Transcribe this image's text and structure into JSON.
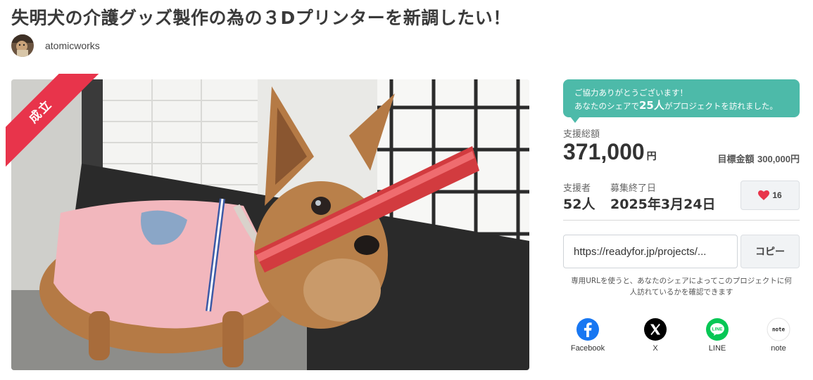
{
  "project": {
    "title": "失明犬の介護グッズ製作の為の３Dプリンターを新調したい！",
    "owner_name": "atomicworks",
    "status_ribbon": "成立"
  },
  "share_banner": {
    "line1": "ご協力ありがとうございます！",
    "line2_prefix": "あなたのシェアで",
    "line2_count": "25人",
    "line2_suffix": "がプロジェクトを訪れました。",
    "color": "#4dbaa9"
  },
  "stats": {
    "total_label": "支援総額",
    "total_amount": "371,000",
    "total_unit": "円",
    "goal_label": "目標金額",
    "goal_value": "300,000円",
    "supporters_label": "支援者",
    "supporters_value": "52人",
    "end_label": "募集終了日",
    "end_value": "2025年3月24日"
  },
  "like": {
    "icon": "heart-icon",
    "count": "16",
    "color": "#e8344b"
  },
  "share_url": {
    "value": "https://readyfor.jp/projects/...",
    "copy_label": "コピー",
    "note": "専用URLを使うと、あなたのシェアによってこのプロジェクトに何人訪れているかを確認できます"
  },
  "social": [
    {
      "name": "Facebook",
      "icon": "facebook-icon",
      "color": "#1877f2"
    },
    {
      "name": "X",
      "icon": "x-icon",
      "color": "#000000"
    },
    {
      "name": "LINE",
      "icon": "line-icon",
      "color": "#06c755"
    },
    {
      "name": "note",
      "icon": "note-icon",
      "color": "#222222"
    }
  ],
  "colors": {
    "ribbon": "#e8344b",
    "accent": "#4dbaa9"
  }
}
